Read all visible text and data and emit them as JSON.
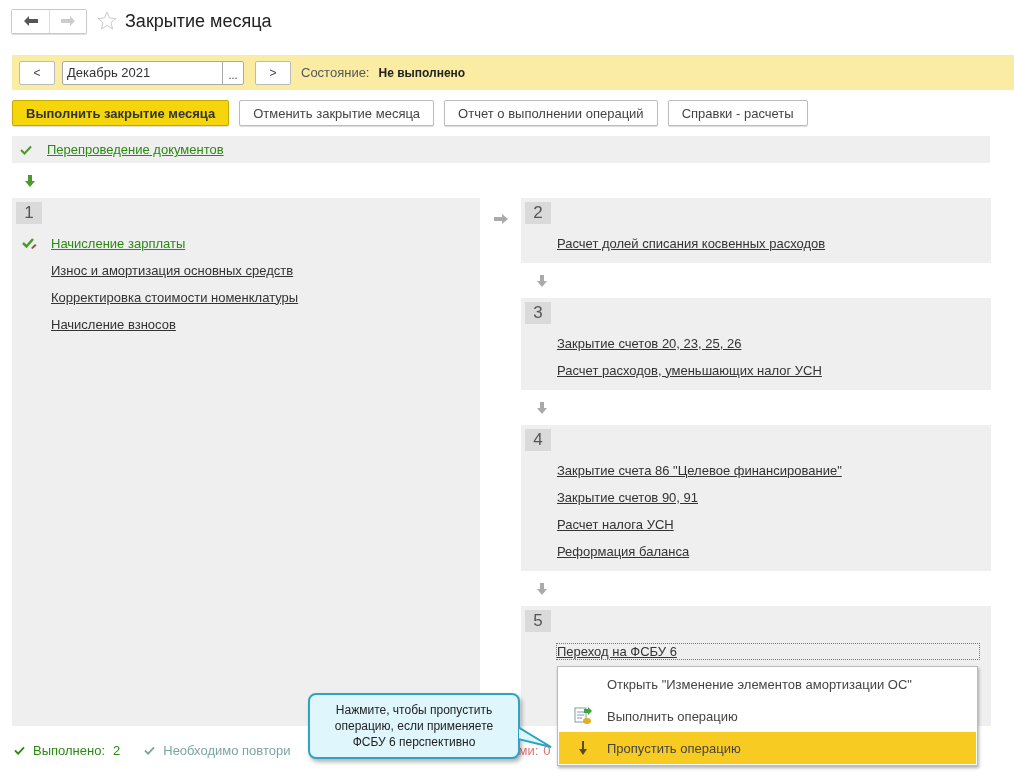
{
  "window": {
    "title": "Закрытие месяца",
    "favorite": false
  },
  "period_bar": {
    "prev": "<",
    "period": "Декабрь 2021",
    "choose": "...",
    "next": ">",
    "state_label": "Состояние:",
    "state_value": "Не выполнено"
  },
  "buttons": [
    {
      "label": "Выполнить закрытие месяца",
      "primary": true
    },
    {
      "label": "Отменить закрытие месяца",
      "primary": false
    },
    {
      "label": "Отчет о выполнении операций",
      "primary": false
    },
    {
      "label": "Справки - расчеты",
      "primary": false
    }
  ],
  "pre_step": {
    "label": "Перепроведение документов",
    "done": true
  },
  "stages": [
    {
      "number": "1",
      "operations": [
        {
          "label": "Начисление зарплаты",
          "done": true,
          "selected": false
        },
        {
          "label": "Износ и амортизация основных средств",
          "done": false,
          "selected": false
        },
        {
          "label": "Корректировка стоимости номенклатуры",
          "done": false,
          "selected": false
        },
        {
          "label": "Начисление взносов",
          "done": false,
          "selected": false
        }
      ]
    },
    {
      "number": "2",
      "operations": [
        {
          "label": "Расчет долей списания косвенных расходов",
          "done": false,
          "selected": false
        }
      ]
    },
    {
      "number": "3",
      "operations": [
        {
          "label": "Закрытие счетов 20, 23, 25, 26",
          "done": false,
          "selected": false
        },
        {
          "label": "Расчет расходов, уменьшающих налог УСН",
          "done": false,
          "selected": false
        }
      ]
    },
    {
      "number": "4",
      "operations": [
        {
          "label": "Закрытие счета 86 \"Целевое финансирование\"",
          "done": false,
          "selected": false
        },
        {
          "label": "Закрытие счетов 90, 91",
          "done": false,
          "selected": false
        },
        {
          "label": "Расчет налога УСН",
          "done": false,
          "selected": false
        },
        {
          "label": "Реформация баланса",
          "done": false,
          "selected": false
        }
      ]
    },
    {
      "number": "5",
      "operations": [
        {
          "label": "Переход на ФСБУ 6",
          "done": false,
          "selected": true
        }
      ]
    }
  ],
  "context_menu": [
    {
      "label": "Открыть \"Изменение элементов амортизации ОС\"",
      "kind": "open",
      "selected": false
    },
    {
      "label": "Выполнить операцию",
      "kind": "execute",
      "selected": false
    },
    {
      "label": "Пропустить операцию",
      "kind": "skip",
      "selected": true
    }
  ],
  "callout": {
    "text": "Нажмите, чтобы пропустить\nоперацию, если применяете\nФСБУ 6 перспективно"
  },
  "status_bar": [
    {
      "kind": "done",
      "label": "Выполнено:",
      "count": "2"
    },
    {
      "kind": "repeat",
      "label": "Необходимо повтори"
    },
    {
      "kind": "error",
      "label": "ми:",
      "count": "0"
    }
  ]
}
